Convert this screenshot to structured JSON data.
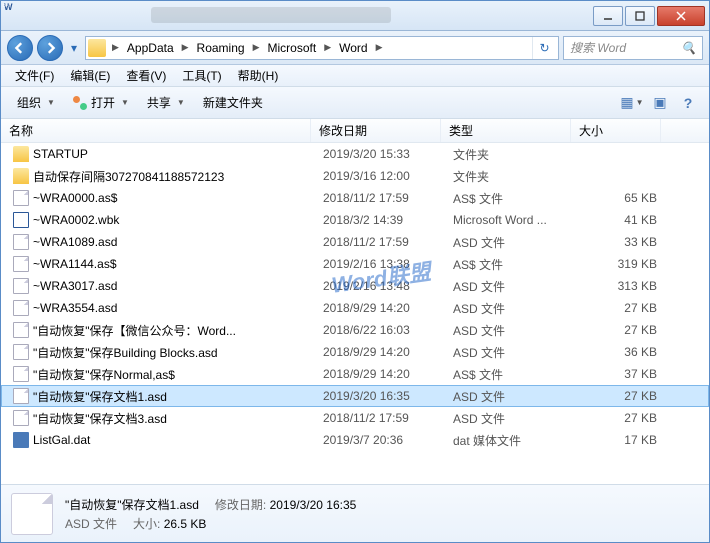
{
  "titlebar": {},
  "breadcrumbs": [
    "AppData",
    "Roaming",
    "Microsoft",
    "Word"
  ],
  "search": {
    "placeholder": "搜索 Word"
  },
  "menu": {
    "file": "文件(F)",
    "edit": "编辑(E)",
    "view": "查看(V)",
    "tools": "工具(T)",
    "help": "帮助(H)"
  },
  "toolbar": {
    "organize": "组织",
    "open": "打开",
    "share": "共享",
    "newfolder": "新建文件夹"
  },
  "columns": {
    "name": "名称",
    "date": "修改日期",
    "type": "类型",
    "size": "大小"
  },
  "files": [
    {
      "icon": "folder",
      "name": "STARTUP",
      "date": "2019/3/20 15:33",
      "type": "文件夹",
      "size": ""
    },
    {
      "icon": "folder",
      "name": "自动保存间隔307270841188572123",
      "date": "2019/3/16 12:00",
      "type": "文件夹",
      "size": ""
    },
    {
      "icon": "file",
      "name": "~WRA0000.as$",
      "date": "2018/11/2 17:59",
      "type": "AS$ 文件",
      "size": "65 KB"
    },
    {
      "icon": "word",
      "name": "~WRA0002.wbk",
      "date": "2018/3/2 14:39",
      "type": "Microsoft Word ...",
      "size": "41 KB"
    },
    {
      "icon": "file",
      "name": "~WRA1089.asd",
      "date": "2018/11/2 17:59",
      "type": "ASD 文件",
      "size": "33 KB"
    },
    {
      "icon": "file",
      "name": "~WRA1144.as$",
      "date": "2019/2/16 13:38",
      "type": "AS$ 文件",
      "size": "319 KB"
    },
    {
      "icon": "file",
      "name": "~WRA3017.asd",
      "date": "2019/2/16 13:48",
      "type": "ASD 文件",
      "size": "313 KB"
    },
    {
      "icon": "file",
      "name": "~WRA3554.asd",
      "date": "2018/9/29 14:20",
      "type": "ASD 文件",
      "size": "27 KB"
    },
    {
      "icon": "file",
      "name": "\"自动恢复\"保存【微信公众号：Word...",
      "date": "2018/6/22 16:03",
      "type": "ASD 文件",
      "size": "27 KB"
    },
    {
      "icon": "file",
      "name": "\"自动恢复\"保存Building Blocks.asd",
      "date": "2018/9/29 14:20",
      "type": "ASD 文件",
      "size": "36 KB"
    },
    {
      "icon": "file",
      "name": "\"自动恢复\"保存Normal,as$",
      "date": "2018/9/29 14:20",
      "type": "AS$ 文件",
      "size": "37 KB"
    },
    {
      "icon": "file",
      "name": "\"自动恢复\"保存文档1.asd",
      "date": "2019/3/20 16:35",
      "type": "ASD 文件",
      "size": "27 KB",
      "selected": true
    },
    {
      "icon": "file",
      "name": "\"自动恢复\"保存文档3.asd",
      "date": "2018/11/2 17:59",
      "type": "ASD 文件",
      "size": "27 KB"
    },
    {
      "icon": "dat",
      "name": "ListGal.dat",
      "date": "2019/3/7 20:36",
      "type": "dat 媒体文件",
      "size": "17 KB"
    }
  ],
  "details": {
    "filename": "\"自动恢复\"保存文档1.asd",
    "date_label": "修改日期:",
    "date_value": "2019/3/20 16:35",
    "type_value": "ASD 文件",
    "size_label": "大小:",
    "size_value": "26.5 KB"
  },
  "watermark": {
    "a": "Word",
    "b": "联盟"
  }
}
